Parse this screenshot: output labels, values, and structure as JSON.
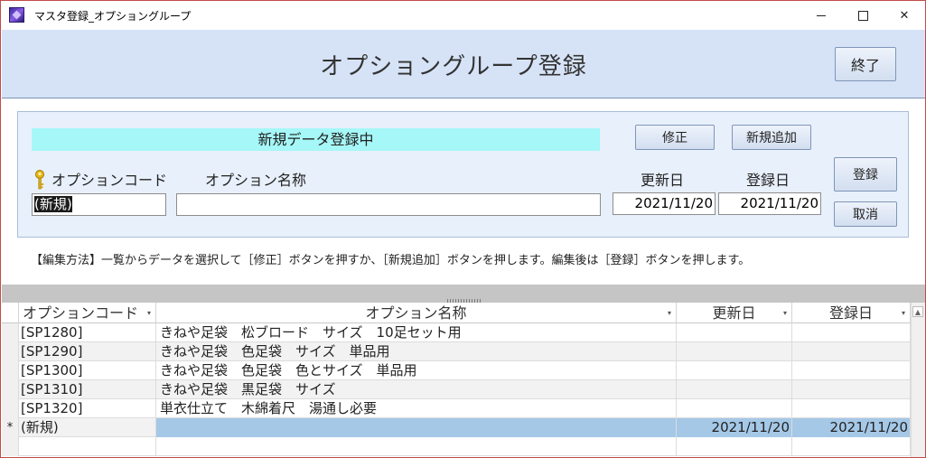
{
  "window": {
    "title": "マスタ登録_オプショングループ",
    "controls": {
      "minimize_icon": "minimize-icon",
      "maximize_icon": "maximize-icon",
      "close_glyph": "✕"
    }
  },
  "header": {
    "title": "オプショングループ登録",
    "exit_label": "終了",
    "background": "#d6e3f7"
  },
  "form": {
    "status_text": "新規データ登録中",
    "status_color": "#a6f7f7",
    "edit_label": "修正",
    "new_label": "新規追加",
    "register_label": "登録",
    "cancel_label": "取消",
    "code_label": "オプションコード",
    "name_label": "オプション名称",
    "updated_label": "更新日",
    "created_label": "登録日",
    "code_value": "(新規)",
    "name_value": "",
    "updated_value": "2021/11/20",
    "created_value": "2021/11/20",
    "key_icon": "key-icon"
  },
  "help": {
    "text": "【編集方法】一覧からデータを選択して［修正］ボタンを押すか、［新規追加］ボタンを押します。編集後は［登録］ボタンを押します。"
  },
  "grid": {
    "columns": {
      "code": "オプションコード",
      "name": "オプション名称",
      "updated": "更新日",
      "created": "登録日"
    },
    "rows": [
      {
        "code": "[SP1280]",
        "name": "きねや足袋　松ブロード　サイズ　10足セット用",
        "updated": "",
        "created": ""
      },
      {
        "code": "[SP1290]",
        "name": "きねや足袋　色足袋　サイズ　単品用",
        "updated": "",
        "created": ""
      },
      {
        "code": "[SP1300]",
        "name": "きねや足袋　色足袋　色とサイズ　単品用",
        "updated": "",
        "created": ""
      },
      {
        "code": "[SP1310]",
        "name": "きねや足袋　黒足袋　サイズ",
        "updated": "",
        "created": ""
      },
      {
        "code": "[SP1320]",
        "name": "単衣仕立て　木綿着尺　湯通し必要",
        "updated": "",
        "created": ""
      }
    ],
    "new_row": {
      "selector": "*",
      "code": "(新規)",
      "name": "",
      "updated": "2021/11/20",
      "created": "2021/11/20"
    },
    "sort_arrow": "▾",
    "new_row_color": "#a5c8e7"
  }
}
